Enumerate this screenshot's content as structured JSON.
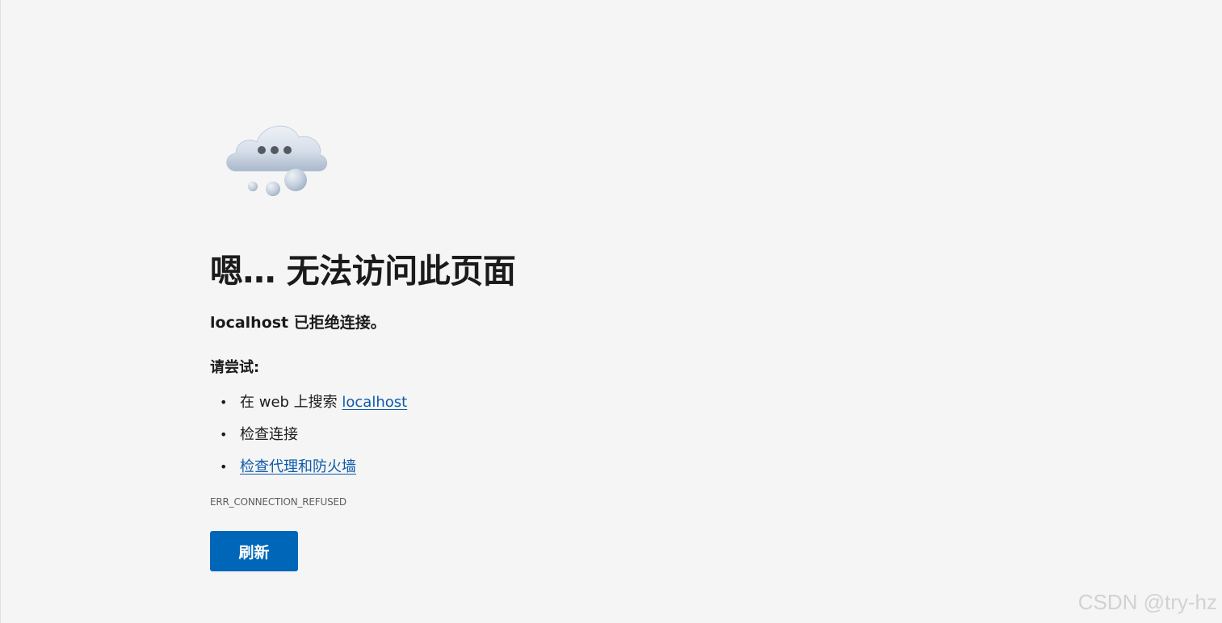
{
  "error_page": {
    "illustration_icon": "thinking-cloud-icon",
    "title": "嗯… 无法访问此页面",
    "subtitle": "localhost 已拒绝连接。",
    "try_label": "请尝试:",
    "suggestions": [
      {
        "prefix": "在 web 上搜索 ",
        "link": "localhost"
      },
      {
        "text": "检查连接"
      },
      {
        "link": "检查代理和防火墙"
      }
    ],
    "bullet": "•",
    "error_code": "ERR_CONNECTION_REFUSED",
    "refresh_label": "刷新"
  },
  "watermark": "CSDN @try-hz",
  "colors": {
    "background": "#f5f5f5",
    "link": "#0f5aa8",
    "button": "#0067b8",
    "button_text": "#ffffff"
  }
}
